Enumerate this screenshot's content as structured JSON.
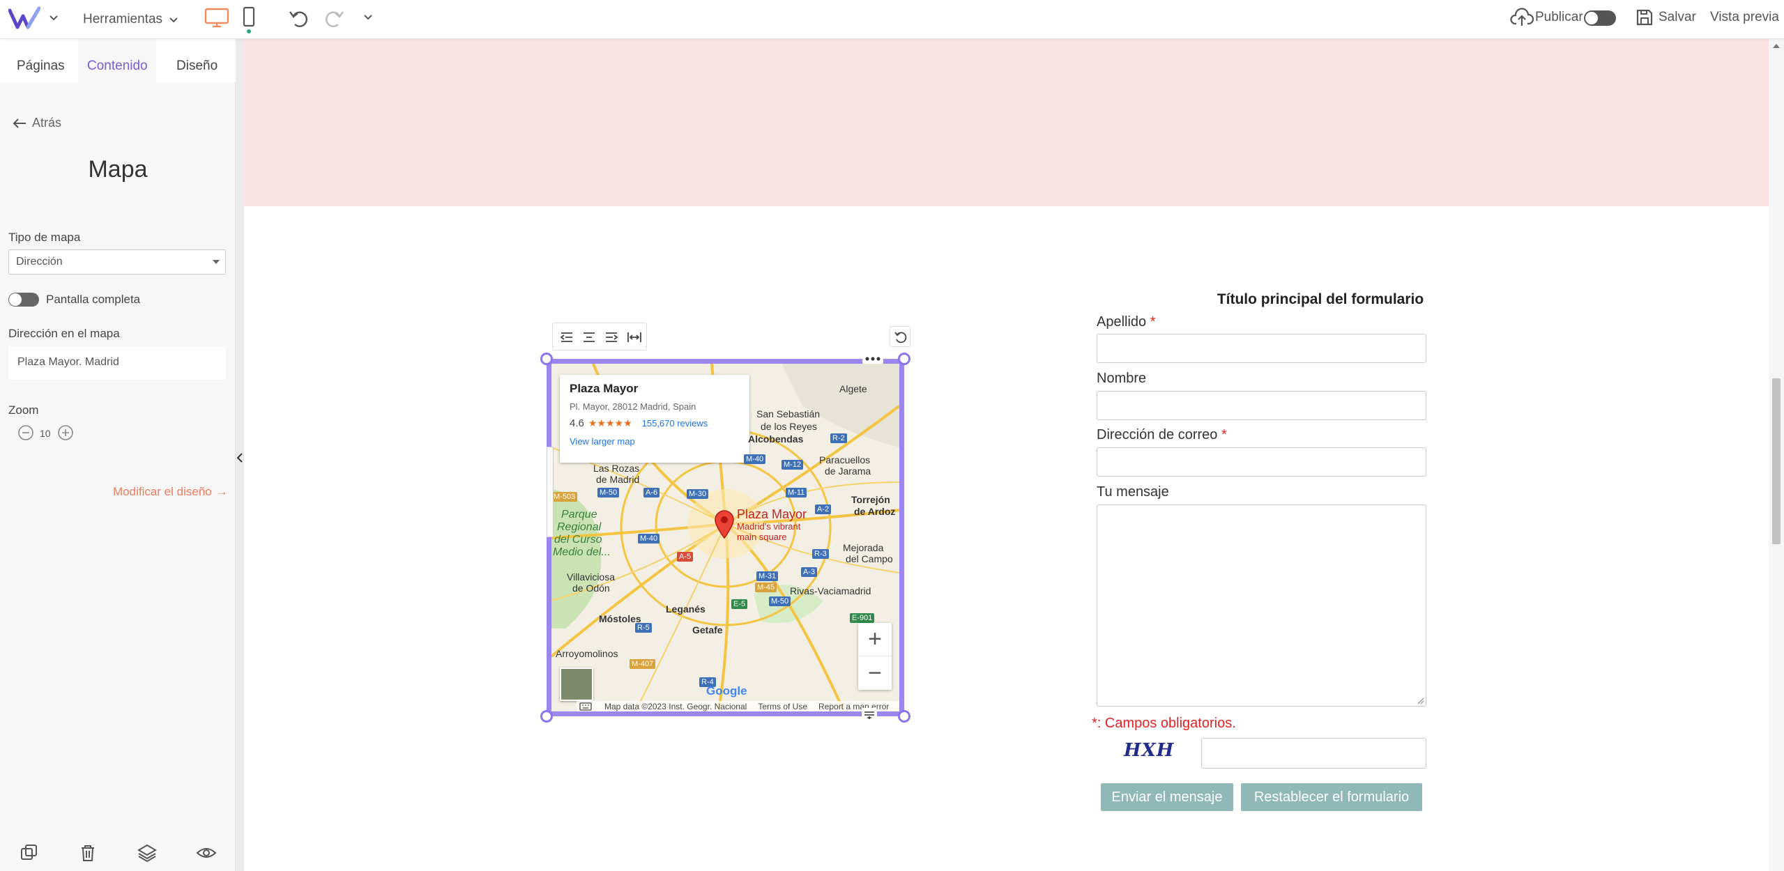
{
  "topbar": {
    "tools_label": "Herramientas",
    "publish_label": "Publicar",
    "save_label": "Salvar",
    "preview_label": "Vista previa",
    "accent_color": "#f08a5d",
    "brand_color": "#5b46c7"
  },
  "sidebar": {
    "tabs": [
      {
        "label": "Páginas"
      },
      {
        "label": "Contenido",
        "active": true
      },
      {
        "label": "Diseño"
      }
    ],
    "back_label": "Atrás",
    "heading": "Mapa",
    "map_type_label": "Tipo de mapa",
    "map_type_value": "Dirección",
    "fullscreen_label": "Pantalla completa",
    "address_label": "Dirección en el mapa",
    "address_value": "Plaza Mayor. Madrid",
    "zoom_label": "Zoom",
    "zoom_value": "10",
    "modify_design_label": "Modificar el diseño",
    "modify_arrow": "→"
  },
  "map": {
    "place_name": "Plaza Mayor",
    "place_address": "Pl. Mayor, 28012 Madrid, Spain",
    "rating": "4.6",
    "stars": "★★★★★",
    "reviews": "155,670 reviews",
    "larger_map_link": "View larger map",
    "marker_title": "Plaza Mayor",
    "marker_subtitle_1": "Madrid's vibrant",
    "marker_subtitle_2": "main square",
    "map_data": "Map data ©2023 Inst. Geogr. Nacional",
    "terms": "Terms of Use",
    "report": "Report a map error",
    "google": "Google",
    "zoom_in": "+",
    "zoom_out": "−",
    "cities": [
      "Algete",
      "San Sebastián",
      "de los Reyes",
      "Alcobendas",
      "Paracuellos",
      "de Jarama",
      "Las Rozas",
      "de Madrid",
      "Torrejón",
      "de Ardoz",
      "Parque",
      "Regional",
      "del Curso",
      "Medio del...",
      "Mejorada",
      "del Campo",
      "Villaviciosa",
      "de Odón",
      "Rivas-Vaciamadrid",
      "Móstoles",
      "Leganés",
      "Getafe",
      "Arroyomolinos"
    ],
    "roads": [
      "M-40",
      "R-2",
      "M-12",
      "M-50",
      "A-6",
      "M-30",
      "M-11",
      "A-2",
      "M-503",
      "M-40",
      "A-5",
      "R-3",
      "A-3",
      "M-31",
      "M-45",
      "M-50",
      "E-5",
      "R-5",
      "E-901",
      "M-407",
      "R-4"
    ]
  },
  "form": {
    "title": "Título principal del formulario",
    "surname_label": "Apellido",
    "name_label": "Nombre",
    "email_label": "Dirección de correo",
    "message_label": "Tu mensaje",
    "required_marker": "*",
    "required_note": "*: Campos obligatorios.",
    "captcha_text": "HXH",
    "send_label": "Enviar el mensaje",
    "reset_label": "Restablecer el formulario",
    "button_color": "#8fb8b6",
    "required_color": "#e22222"
  }
}
